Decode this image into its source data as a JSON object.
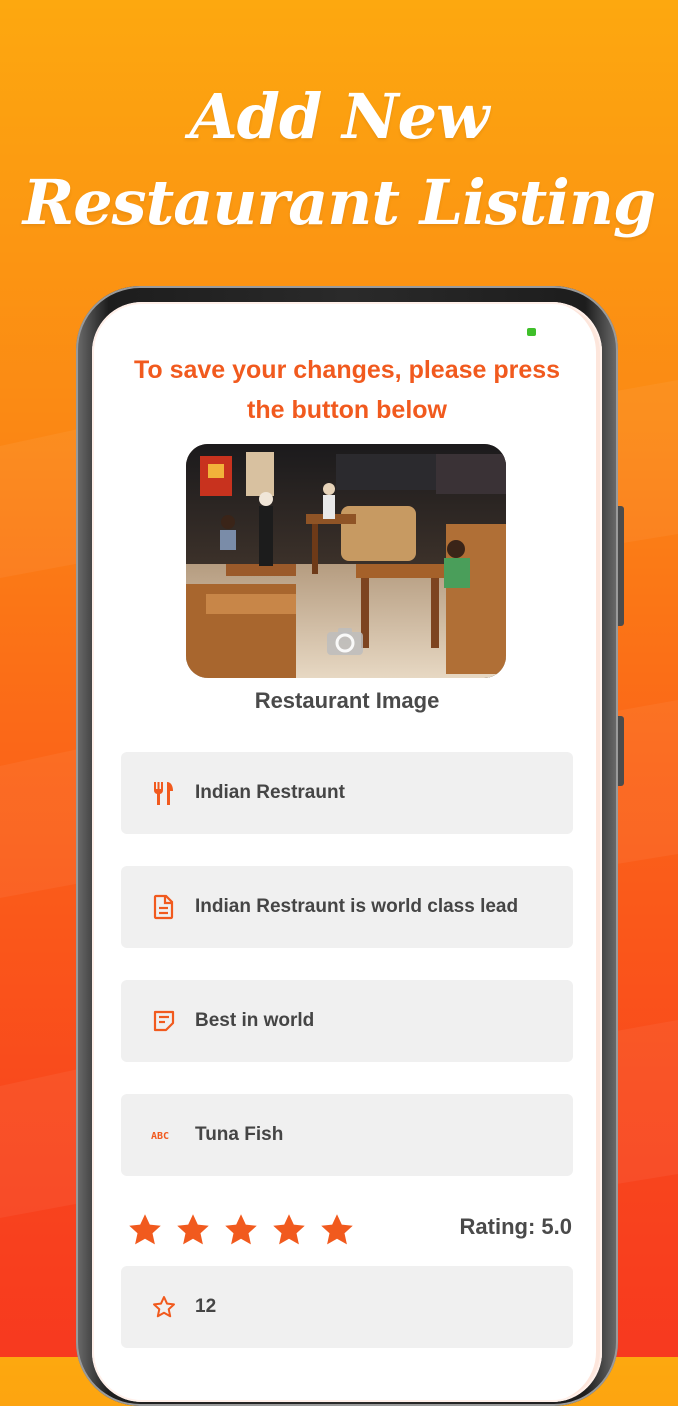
{
  "headline": {
    "line1": "Add New",
    "line2": "Restaurant Listing"
  },
  "screen": {
    "instruction": "To save your changes, please press the button below",
    "image_label": "Restaurant Image",
    "fields": [
      {
        "icon": "fork-knife-icon",
        "value": "Indian Restraunt"
      },
      {
        "icon": "document-icon",
        "value": "Indian Restraunt is world class lead"
      },
      {
        "icon": "note-icon",
        "value": "Best in world"
      },
      {
        "icon": "abc-icon",
        "value": "Tuna Fish"
      }
    ],
    "stars": 5,
    "rating_text": "Rating: 5.0",
    "count_field": {
      "icon": "star-outline-icon",
      "value": "12"
    }
  },
  "colors": {
    "accent": "#f15a1e",
    "field_bg": "#f0f0f0",
    "battery": "#3fbf2a"
  }
}
